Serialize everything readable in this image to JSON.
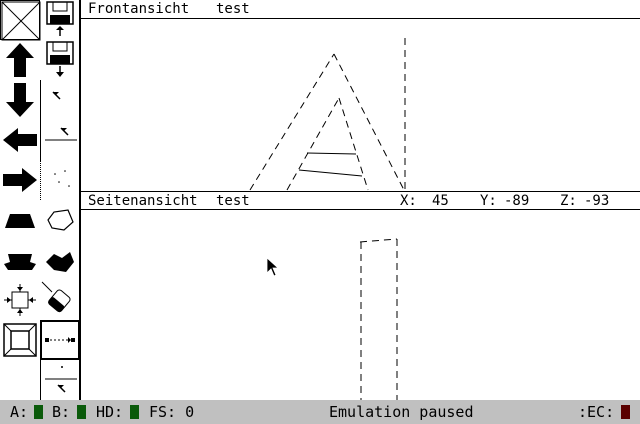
{
  "toolbar": {
    "tools": [
      {
        "name": "clear-icon"
      },
      {
        "name": "save-icon"
      },
      {
        "name": "arrow-up-icon"
      },
      {
        "name": "load-icon"
      },
      {
        "name": "arrow-down-icon"
      },
      {
        "name": "cursor-small-icon"
      },
      {
        "name": "arrow-left-icon"
      },
      {
        "name": "cursor-small-2-icon"
      },
      {
        "name": "arrow-right-icon"
      },
      {
        "name": "dots-icon"
      },
      {
        "name": "shape-flat-icon"
      },
      {
        "name": "shape-outline-icon"
      },
      {
        "name": "shape-hat-icon"
      },
      {
        "name": "shape-rotated-icon"
      },
      {
        "name": "move-center-icon"
      },
      {
        "name": "eraser-icon"
      },
      {
        "name": "frame-icon"
      },
      {
        "name": "line-dashed-icon"
      },
      {
        "name": "blank-icon"
      },
      {
        "name": "dot-cursor-icon"
      }
    ]
  },
  "front_view": {
    "title": "Frontansicht",
    "object_name": "test"
  },
  "side_view": {
    "title": "Seitenansicht",
    "object_name": "test",
    "coords": {
      "x_label": "X:",
      "x_value": "45",
      "y_label": "Y:",
      "y_value": "-89",
      "z_label": "Z:",
      "z_value": "-93"
    }
  },
  "statusbar": {
    "a_label": "A:",
    "b_label": "B:",
    "hd_label": "HD:",
    "fs_label": "FS: 0",
    "message": "Emulation paused",
    "ec_label": ":EC:",
    "led_color": "#0a5a0a",
    "ec_led_color": "#5a0000"
  }
}
